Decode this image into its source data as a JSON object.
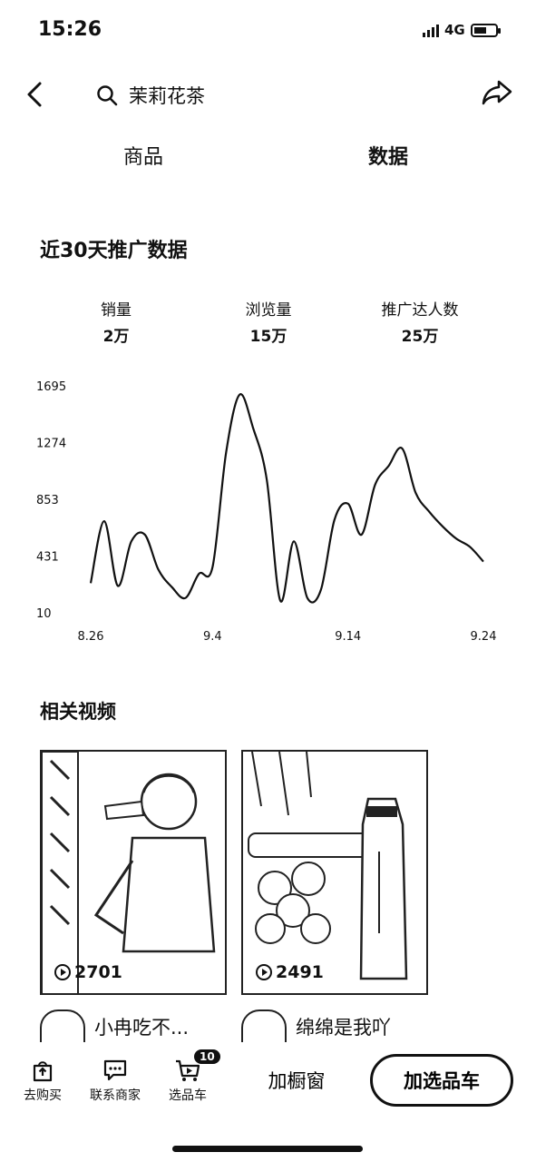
{
  "status_bar": {
    "time": "15:26",
    "network": "4G"
  },
  "header": {
    "search_text": "茉莉花茶"
  },
  "tabs": {
    "goods": "商品",
    "data": "数据"
  },
  "section_title": "近30天推广数据",
  "metrics": [
    {
      "label": "销量",
      "value": "2万"
    },
    {
      "label": "浏览量",
      "value": "15万"
    },
    {
      "label": "推广达人数",
      "value": "25万"
    }
  ],
  "chart_data": {
    "type": "line",
    "x": [
      0,
      1,
      2,
      3,
      4,
      5,
      6,
      7,
      8,
      9,
      10,
      11,
      12,
      13,
      14,
      15,
      16,
      17,
      18,
      19,
      20,
      21,
      22,
      23,
      24,
      25,
      26,
      27,
      28,
      29
    ],
    "x_tick_labels": [
      "8.26",
      "9.4",
      "9.14",
      "9.24"
    ],
    "x_tick_index": [
      0,
      9,
      19,
      29
    ],
    "y_ticks": [
      10,
      431,
      853,
      1274,
      1695
    ],
    "ylim": [
      10,
      1695
    ],
    "series": [
      {
        "values": [
          230,
          690,
          210,
          540,
          590,
          330,
          200,
          120,
          300,
          350,
          1200,
          1630,
          1380,
          1000,
          100,
          540,
          120,
          180,
          700,
          820,
          590,
          960,
          1100,
          1230,
          900,
          760,
          650,
          560,
          500,
          390
        ]
      }
    ]
  },
  "videos_title": "相关视频",
  "videos": [
    {
      "plays": "2701",
      "author": "小冉吃不..."
    },
    {
      "plays": "2491",
      "author": "绵绵是我吖"
    }
  ],
  "bottom_bar": {
    "buy": "去购买",
    "contact": "联系商家",
    "cart": "选品车",
    "cart_badge": "10",
    "window": "加橱窗",
    "add_cart": "加选品车"
  }
}
